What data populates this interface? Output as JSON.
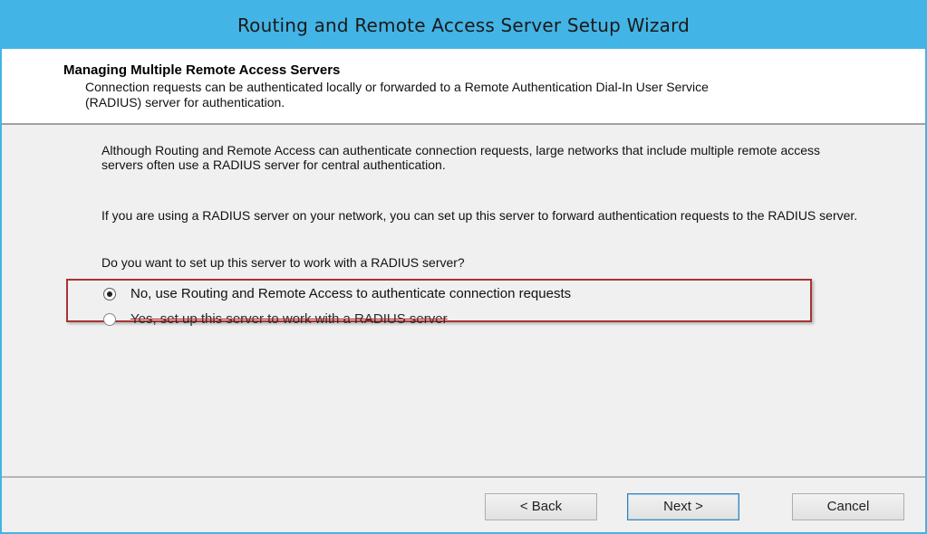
{
  "window": {
    "title": "Routing and Remote Access Server Setup Wizard"
  },
  "header": {
    "title": "Managing Multiple Remote Access Servers",
    "description": "Connection requests can be authenticated locally or forwarded to a Remote Authentication Dial-In User Service (RADIUS) server for authentication."
  },
  "body": {
    "paragraph1": "Although Routing and Remote Access can authenticate connection requests, large networks that include multiple remote access servers often use a RADIUS server for central authentication.",
    "paragraph2": "If you are using a RADIUS server on your network, you can set up this server to forward authentication requests to the RADIUS server.",
    "question": "Do you want to set up this server to work with a RADIUS server?",
    "options": [
      {
        "label": "No, use Routing and Remote Access to authenticate connection requests",
        "selected": true
      },
      {
        "label": "Yes, set up this server to work with a RADIUS server",
        "selected": false
      }
    ]
  },
  "footer": {
    "back_label": "< Back",
    "next_label": "Next >",
    "cancel_label": "Cancel"
  },
  "colors": {
    "titlebar": "#43b4e6",
    "highlight_border": "#a83333",
    "panel_background": "#f0f0f0"
  }
}
